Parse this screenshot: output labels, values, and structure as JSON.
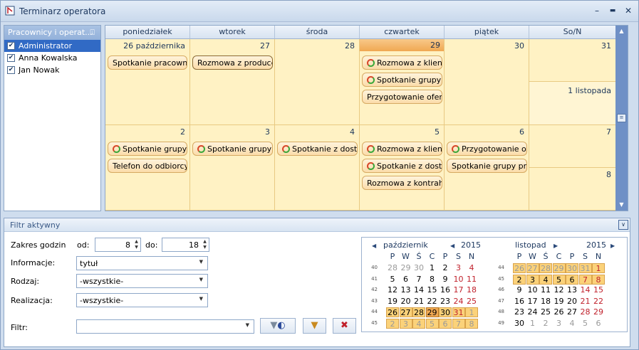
{
  "window": {
    "title": "Terminarz operatora",
    "min": "–",
    "max": "▬",
    "close": "✕"
  },
  "left_panel": {
    "title": "Pracownicy i operat...",
    "pin": "⍗",
    "items": [
      {
        "label": "Administrator",
        "checked": true,
        "selected": true
      },
      {
        "label": "Anna Kowalska",
        "checked": true,
        "selected": false
      },
      {
        "label": "Jan Nowak",
        "checked": true,
        "selected": false
      }
    ]
  },
  "calendar": {
    "day_headers": [
      "poniedziałek",
      "wtorek",
      "środa",
      "czwartek",
      "piątek",
      "So/N"
    ],
    "week1": {
      "days": [
        "26 października",
        "27",
        "28",
        "29",
        "30",
        "31",
        "1 listopada"
      ],
      "events": {
        "mon": [
          "Spotkanie pracownik"
        ],
        "tue": [
          "Rozmowa z produce"
        ],
        "thu": [
          "Rozmowa z klient",
          "Spotkanie grupy p",
          "Przygotowanie ofert"
        ]
      }
    },
    "week2": {
      "days": [
        "2",
        "3",
        "4",
        "5",
        "6",
        "7",
        "8"
      ],
      "events": {
        "mon": [
          "Spotkanie grupy",
          "Telefon do odbiorcy"
        ],
        "tue": [
          "Spotkanie grupy p"
        ],
        "wed": [
          "Spotkanie z dosta"
        ],
        "thu": [
          "Rozmowa z klient",
          "Spotkanie z dosta",
          "Rozmowa z kontrahe"
        ],
        "fri": [
          "Przygotowanie o",
          "Spotkanie grupy proc"
        ]
      }
    }
  },
  "filter": {
    "title": "Filtr aktywny",
    "zakres_label": "Zakres godzin",
    "od_label": "od:",
    "od_value": "8",
    "do_label": "do:",
    "do_value": "18",
    "informacje_label": "Informacje:",
    "informacje_value": "tytuł",
    "rodzaj_label": "Rodzaj:",
    "rodzaj_value": "-wszystkie-",
    "realizacja_label": "Realizacja:",
    "realizacja_value": "-wszystkie-",
    "filtr_label": "Filtr:",
    "filtr_value": ""
  },
  "mini_calendar": {
    "months": [
      {
        "name": "październik",
        "year": "2015"
      },
      {
        "name": "listopad",
        "year": "2015"
      }
    ],
    "dow": [
      "P",
      "W",
      "Ś",
      "C",
      "P",
      "S",
      "N"
    ]
  }
}
